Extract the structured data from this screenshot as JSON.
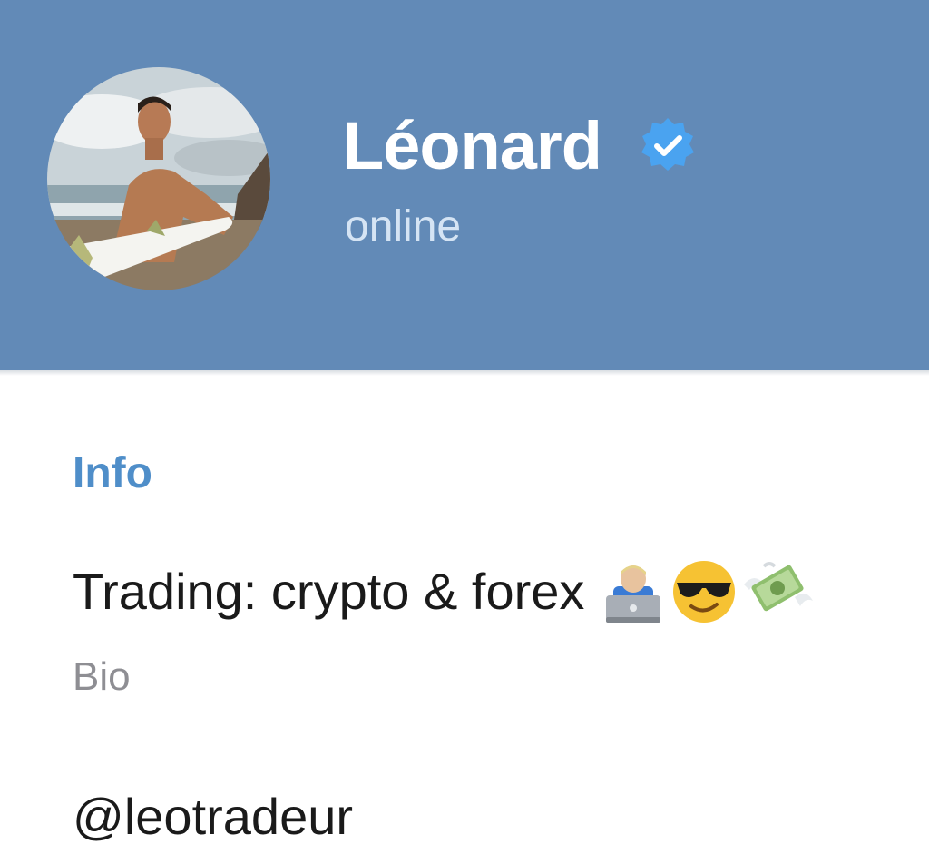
{
  "profile": {
    "name": "Léonard",
    "status": "online",
    "avatar_icon": "profile-photo",
    "verified_icon": "verified-badge-icon"
  },
  "info": {
    "section_title": "Info",
    "bio_text": "Trading: crypto & forex",
    "bio_emojis": [
      "technologist-emoji",
      "sunglasses-face-emoji",
      "money-with-wings-emoji"
    ],
    "bio_label": "Bio",
    "username": "@leotradeur"
  },
  "colors": {
    "header_background": "#628ab7",
    "accent": "#4f8ec9",
    "status_text": "#d5e4f4",
    "secondary_text": "#8e8e93"
  }
}
